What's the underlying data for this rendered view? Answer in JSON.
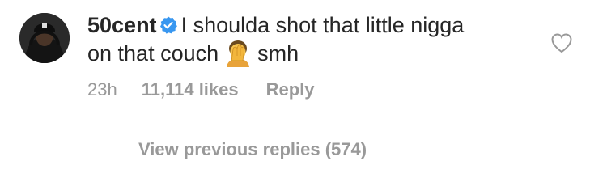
{
  "comment": {
    "username": "50cent",
    "verified_icon": "verified-badge-icon",
    "text_line1": "I shoulda shot that little nigga",
    "text_line2": "on that couch",
    "emoji_icon": "facepalm-emoji-icon",
    "text_end": "smh",
    "timestamp": "23h",
    "likes": "11,114 likes",
    "reply_label": "Reply",
    "like_icon": "heart-outline-icon",
    "view_replies_label": "View previous replies (574)"
  },
  "colors": {
    "text": "#262626",
    "meta": "#999999",
    "verified": "#3897f0",
    "divider": "#c7c7c7"
  }
}
